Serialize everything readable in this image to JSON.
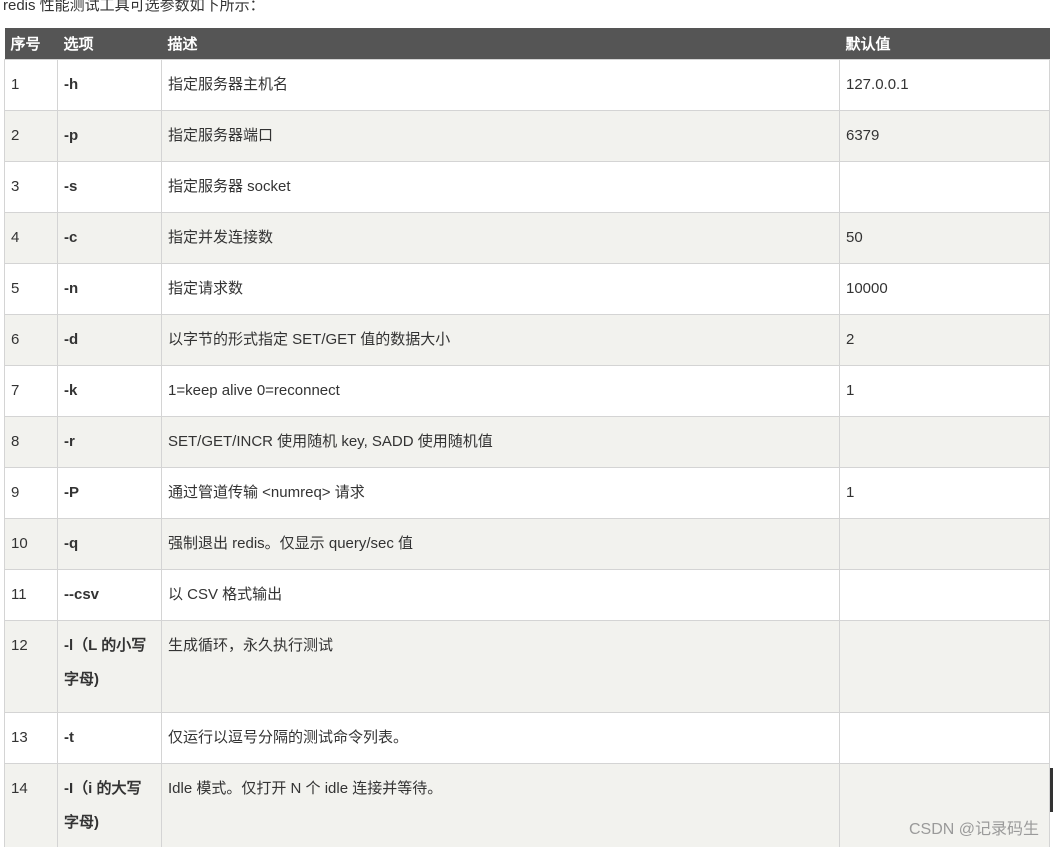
{
  "intro": "redis 性能测试工具可选参数如下所示：",
  "table": {
    "headers": {
      "no": "序号",
      "option": "选项",
      "description": "描述",
      "default": "默认值"
    },
    "rows": [
      {
        "no": "1",
        "option": "-h",
        "description": "指定服务器主机名",
        "default": "127.0.0.1"
      },
      {
        "no": "2",
        "option": "-p",
        "description": "指定服务器端口",
        "default": "6379"
      },
      {
        "no": "3",
        "option": "-s",
        "description": "指定服务器 socket",
        "default": ""
      },
      {
        "no": "4",
        "option": "-c",
        "description": "指定并发连接数",
        "default": "50"
      },
      {
        "no": "5",
        "option": "-n",
        "description": "指定请求数",
        "default": "10000"
      },
      {
        "no": "6",
        "option": "-d",
        "description": "以字节的形式指定 SET/GET 值的数据大小",
        "default": "2"
      },
      {
        "no": "7",
        "option": "-k",
        "description": "1=keep alive 0=reconnect",
        "default": "1"
      },
      {
        "no": "8",
        "option": "-r",
        "description": "SET/GET/INCR 使用随机 key, SADD 使用随机值",
        "default": ""
      },
      {
        "no": "9",
        "option": "-P",
        "description": "通过管道传输 <numreq> 请求",
        "default": "1"
      },
      {
        "no": "10",
        "option": "-q",
        "description": "强制退出 redis。仅显示 query/sec 值",
        "default": ""
      },
      {
        "no": "11",
        "option": "--csv",
        "description": "以 CSV 格式输出",
        "default": ""
      },
      {
        "no": "12",
        "option": "-l（L 的小写字母)",
        "description": "生成循环，永久执行测试",
        "default": ""
      },
      {
        "no": "13",
        "option": "-t",
        "description": "仅运行以逗号分隔的测试命令列表。",
        "default": ""
      },
      {
        "no": "14",
        "option": "-I（i 的大写字母)",
        "description": "Idle 模式。仅打开 N 个 idle 连接并等待。",
        "default": ""
      }
    ]
  },
  "watermark": "CSDN @记录码生"
}
